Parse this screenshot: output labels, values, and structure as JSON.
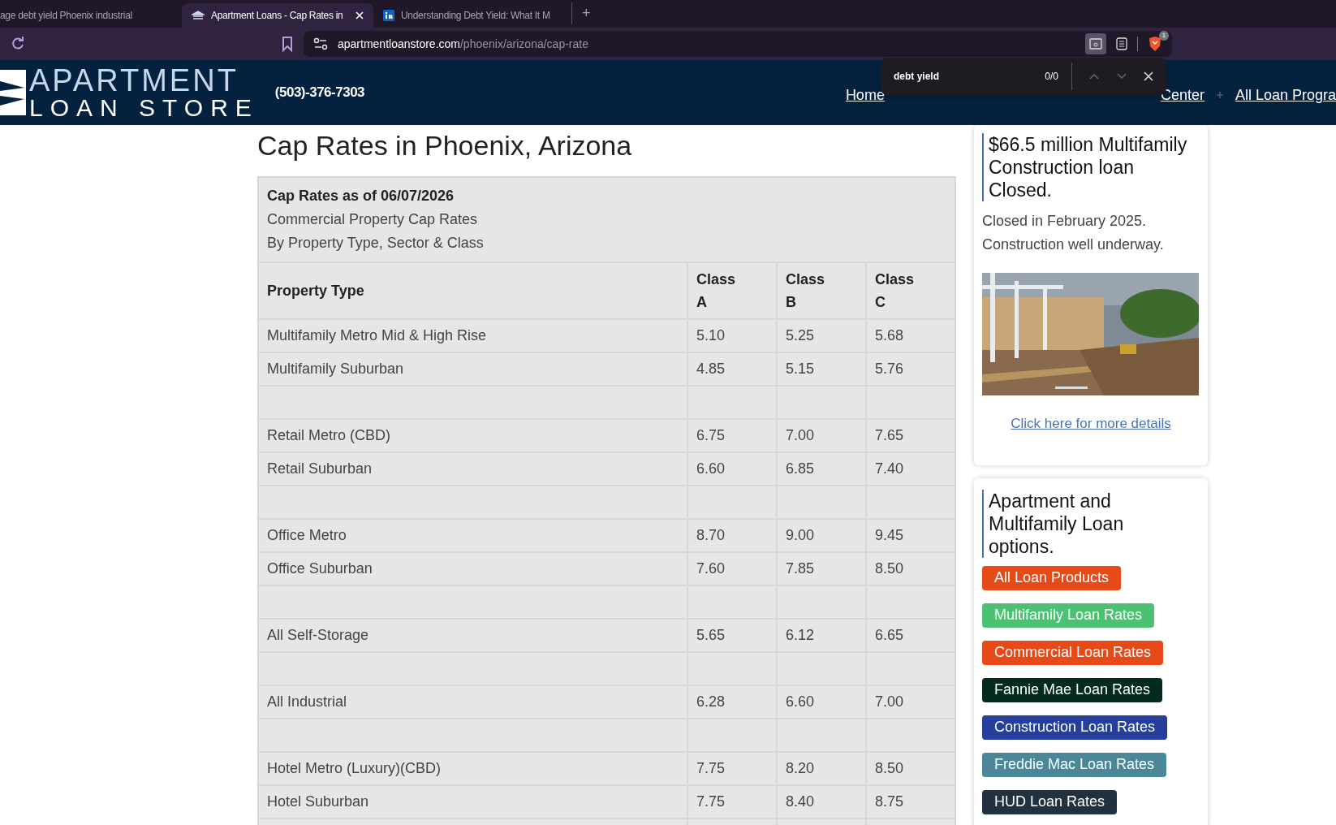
{
  "browser": {
    "tabs": [
      {
        "title": "age debt yield Phoenix industrial",
        "selected": false
      },
      {
        "title": "Apartment Loans - Cap Rates in",
        "selected": true
      },
      {
        "title": "Understanding Debt Yield: What It M",
        "selected": false
      }
    ],
    "new_tab": "+",
    "url_host": "apartmentloanstore.com",
    "url_path": "/phoenix/arizona/cap-rate",
    "shields_count": "1"
  },
  "find_bar": {
    "query": "debt yield",
    "count": "0/0"
  },
  "header": {
    "logo_top": "APARTMENT",
    "logo_bottom": "LOAN STORE",
    "phone": "(503)-376-7303",
    "nav": [
      "Home",
      "Center",
      "All Loan Progra"
    ]
  },
  "page_title": "Cap Rates in Phoenix, Arizona",
  "table": {
    "caption": [
      "Cap Rates as of 06/07/2026",
      "Commercial Property Cap Rates",
      "By Property Type, Sector & Class"
    ],
    "columns": [
      "Property Type",
      "Class\nA",
      "Class\nB",
      "Class\nC"
    ],
    "rows": [
      [
        "Multifamily Metro Mid & High Rise",
        "5.10",
        "5.25",
        "5.68"
      ],
      [
        "Multifamily Suburban",
        "4.85",
        "5.15",
        "5.76"
      ],
      [],
      [
        "Retail Metro (CBD)",
        "6.75",
        "7.00",
        "7.65"
      ],
      [
        "Retail Suburban",
        "6.60",
        "6.85",
        "7.40"
      ],
      [],
      [
        "Office Metro",
        "8.70",
        "9.00",
        "9.45"
      ],
      [
        "Office Suburban",
        "7.60",
        "7.85",
        "8.50"
      ],
      [],
      [
        "All Self-Storage",
        "5.65",
        "6.12",
        "6.65"
      ],
      [],
      [
        "All Industrial",
        "6.28",
        "6.60",
        "7.00"
      ],
      [],
      [
        "Hotel Metro (Luxury)(CBD)",
        "7.75",
        "8.20",
        "8.50"
      ],
      [
        "Hotel Suburban",
        "7.75",
        "8.40",
        "8.75"
      ],
      []
    ]
  },
  "news_card": {
    "heading": "$66.5 million Multifamily Construction loan Closed.",
    "lines": [
      "Closed in February 2025.",
      "Construction well underway."
    ],
    "image": {
      "kind": "picture"
    },
    "link": "Click here for more details"
  },
  "loan_card": {
    "heading": "Apartment and Multifamily Loan options.",
    "buttons": [
      {
        "label": "All Loan Products",
        "color": "#e64a19"
      },
      {
        "label": "Multifamily Loan Rates",
        "color": "#4cc172"
      },
      {
        "label": "Commercial Loan Rates",
        "color": "#e64a19"
      },
      {
        "label": "Fannie Mae Loan Rates",
        "color": "#032b1f"
      },
      {
        "label": "Construction Loan Rates",
        "color": "#263f9c"
      },
      {
        "label": "Freddie Mac Loan Rates",
        "color": "#4a8799"
      },
      {
        "label": "HUD Loan Rates",
        "color": "#22313f"
      }
    ]
  }
}
